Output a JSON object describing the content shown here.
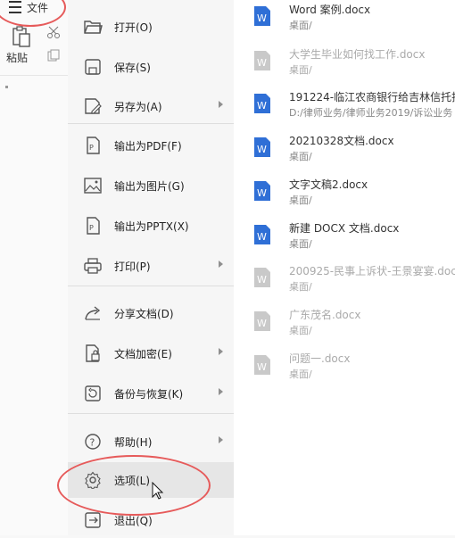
{
  "toolbar": {
    "file_label": "文件",
    "paste_label": "粘贴"
  },
  "menu": {
    "items": [
      {
        "label": "打开(O)",
        "icon": "folder-open-icon"
      },
      {
        "label": "保存(S)",
        "icon": "save-icon"
      },
      {
        "label": "另存为(A)",
        "icon": "save-as-icon"
      },
      {
        "label": "输出为PDF(F)",
        "icon": "export-pdf-icon"
      },
      {
        "label": "输出为图片(G)",
        "icon": "export-image-icon"
      },
      {
        "label": "输出为PPTX(X)",
        "icon": "export-pptx-icon"
      },
      {
        "label": "打印(P)",
        "icon": "print-icon"
      },
      {
        "label": "分享文档(D)",
        "icon": "share-icon"
      },
      {
        "label": "文档加密(E)",
        "icon": "encrypt-icon"
      },
      {
        "label": "备份与恢复(K)",
        "icon": "backup-icon"
      },
      {
        "label": "帮助(H)",
        "icon": "help-icon"
      },
      {
        "label": "选项(L)",
        "icon": "settings-icon"
      },
      {
        "label": "退出(Q)",
        "icon": "exit-icon"
      }
    ]
  },
  "recent_files": [
    {
      "name": "Word 案例.docx",
      "path": "桌面/",
      "faded": false
    },
    {
      "name": "大学生毕业如何找工作.docx",
      "path": "桌面/",
      "faded": true
    },
    {
      "name": "191224-临江农商银行给吉林信托指",
      "path": "D:/律师业务/律师业务2019/诉讼业务",
      "faded": false
    },
    {
      "name": "20210328文档.docx",
      "path": "桌面/",
      "faded": false
    },
    {
      "name": "文字文稿2.docx",
      "path": "桌面/",
      "faded": false
    },
    {
      "name": "新建 DOCX 文档.docx",
      "path": "桌面/",
      "faded": false
    },
    {
      "name": "200925-民事上诉状-王景宴宴.doc",
      "path": "桌面/",
      "faded": true
    },
    {
      "name": "广东茂名.docx",
      "path": "桌面/",
      "faded": true
    },
    {
      "name": "问题一.docx",
      "path": "桌面/",
      "faded": true
    }
  ],
  "colors": {
    "word_blue": "#2f6fd6",
    "faded_gray": "#c9c9c9",
    "annotation_red": "#e65a5a"
  }
}
